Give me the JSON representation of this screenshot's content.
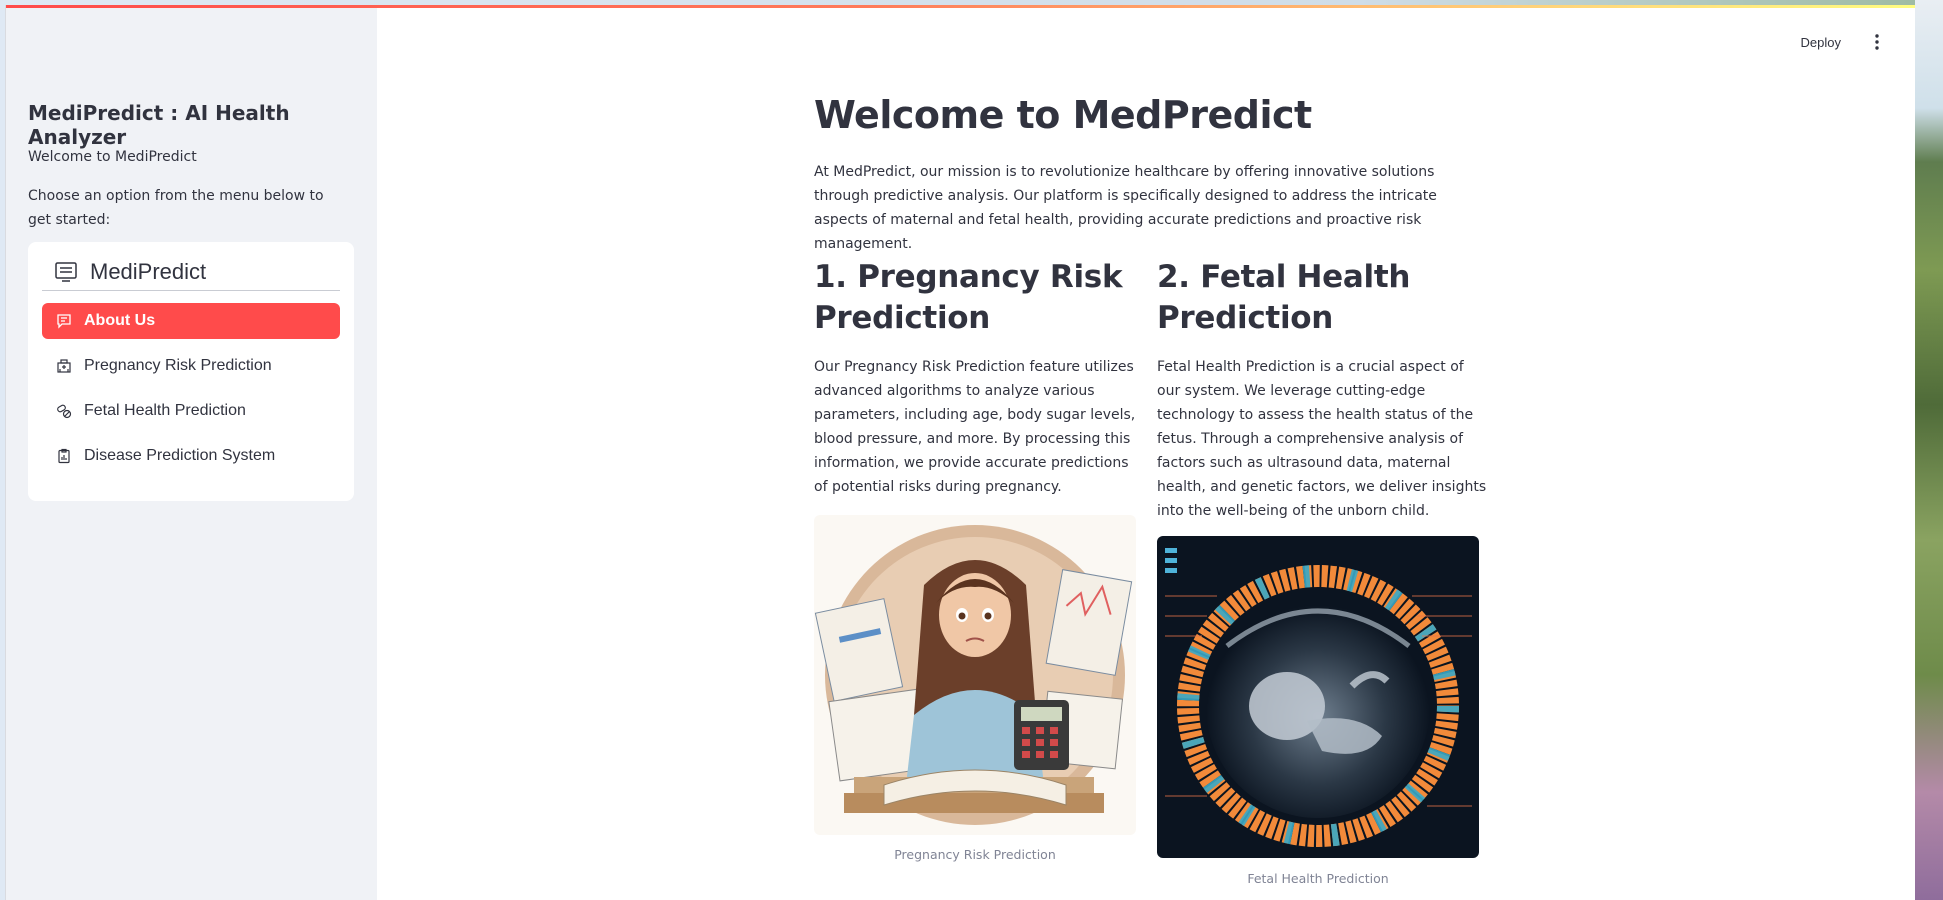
{
  "sidebar": {
    "app_title": "MediPredict : AI Health Analyzer",
    "welcome": "Welcome to MediPredict",
    "instruction": "Choose an option from the menu below to get started:",
    "menu": {
      "title": "MediPredict",
      "items": [
        {
          "label": "About Us",
          "active": true,
          "icon": "chat-square-text-icon"
        },
        {
          "label": "Pregnancy Risk Prediction",
          "active": false,
          "icon": "hospital-icon"
        },
        {
          "label": "Fetal Health Prediction",
          "active": false,
          "icon": "capsule-pill-icon"
        },
        {
          "label": "Disease Prediction System",
          "active": false,
          "icon": "clipboard-data-icon"
        }
      ]
    }
  },
  "toolbar": {
    "deploy_label": "Deploy",
    "menu_icon": "vertical-ellipsis-icon"
  },
  "main": {
    "title": "Welcome to MedPredict",
    "intro": "At MedPredict, our mission is to revolutionize healthcare by offering innovative solutions through predictive analysis. Our platform is specifically designed to address the intricate aspects of maternal and fetal health, providing accurate predictions and proactive risk management.",
    "sections": [
      {
        "heading": "1. Pregnancy Risk Prediction",
        "body": "Our Pregnancy Risk Prediction feature utilizes advanced algorithms to analyze various parameters, including age, body sugar levels, blood pressure, and more. By processing this information, we provide accurate predictions of potential risks during pregnancy.",
        "caption": "Pregnancy Risk Prediction"
      },
      {
        "heading": "2. Fetal Health Prediction",
        "body": "Fetal Health Prediction is a crucial aspect of our system. We leverage cutting-edge technology to assess the health status of the fetus. Through a comprehensive analysis of factors such as ultrasound data, maternal health, and genetic factors, we deliver insights into the well-being of the unborn child.",
        "caption": "Fetal Health Prediction"
      }
    ]
  },
  "colors": {
    "accent": "#ff4b4b",
    "sidebar_bg": "#f0f2f6",
    "text": "#31333f",
    "caption": "#808495"
  }
}
